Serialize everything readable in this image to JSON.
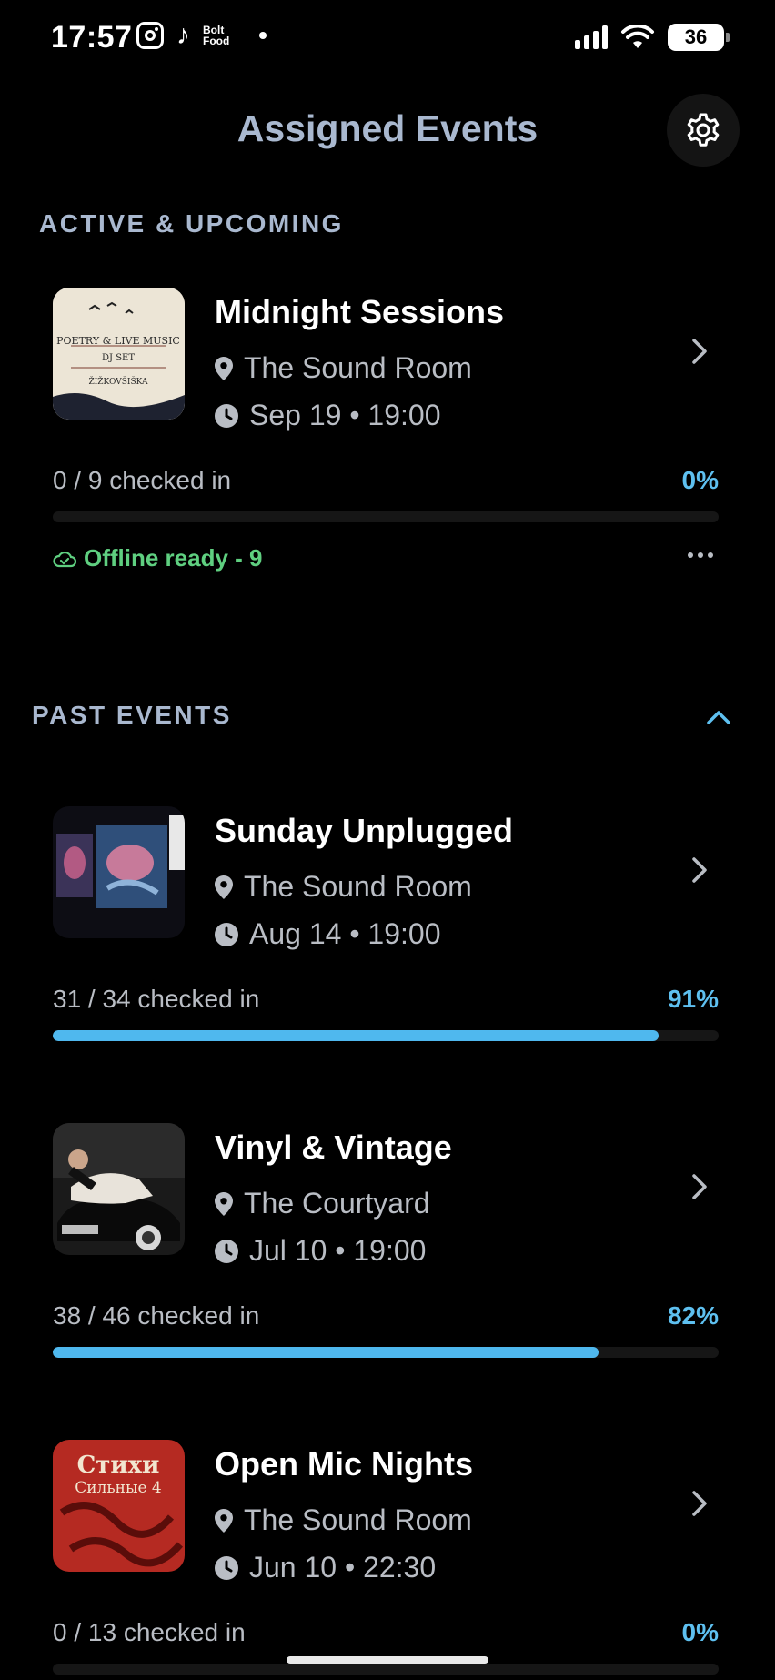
{
  "status_bar": {
    "time": "17:57",
    "bolt_label": "Bolt Food",
    "battery": "36"
  },
  "header": {
    "title": "Assigned Events",
    "settings_icon": "gear-icon"
  },
  "sections": {
    "active_label": "ACTIVE & UPCOMING",
    "past_label": "PAST EVENTS"
  },
  "active_events": [
    {
      "title": "Midnight Sessions",
      "venue": "The Sound Room",
      "datetime": "Sep 19 • 19:00",
      "checked_in": "0 / 9 checked in",
      "percent": "0%",
      "progress": 0,
      "offline_status": "Offline ready - 9",
      "poster_text": "POETRY & LIVE MUSIC",
      "poster_sub": "DJ SET",
      "poster_name": "ŽIŽKOVŠIŠKA"
    }
  ],
  "past_events": [
    {
      "title": "Sunday Unplugged",
      "venue": "The Sound Room",
      "datetime": "Aug 14 • 19:00",
      "checked_in": "31 / 34 checked in",
      "percent": "91%",
      "progress": 0.91
    },
    {
      "title": "Vinyl & Vintage",
      "venue": "The Courtyard",
      "datetime": "Jul 10 • 19:00",
      "checked_in": "38 / 46 checked in",
      "percent": "82%",
      "progress": 0.82
    },
    {
      "title": "Open Mic Nights",
      "venue": "The Sound Room",
      "datetime": "Jun 10 • 22:30",
      "checked_in": "0 / 13 checked in",
      "percent": "0%",
      "progress": 0,
      "poster_text": "Стихи",
      "poster_sub": "Сильные 4"
    }
  ],
  "colors": {
    "accent": "#4fb8ee",
    "title_gray": "#a9b8cf",
    "offline_green": "#5fcf80"
  }
}
